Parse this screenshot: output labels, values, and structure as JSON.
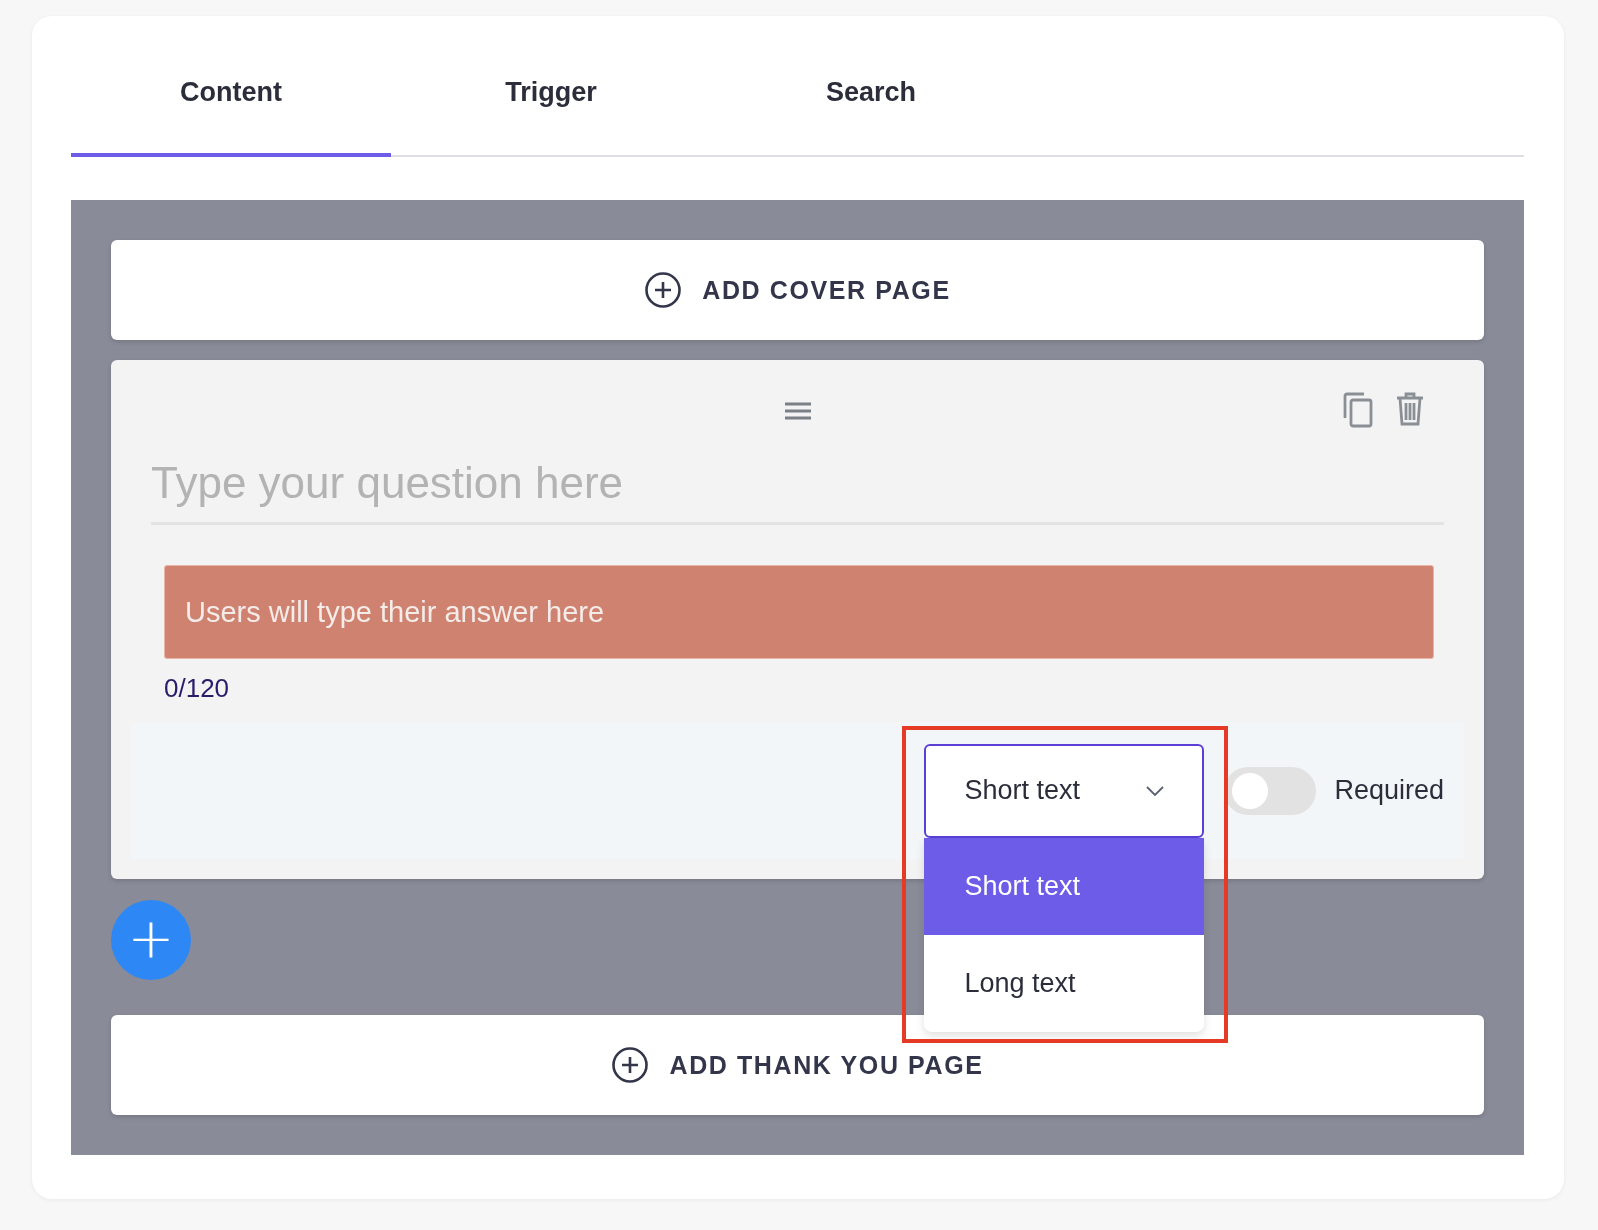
{
  "tabs": [
    {
      "label": "Content",
      "selected": true
    },
    {
      "label": "Trigger",
      "selected": false
    },
    {
      "label": "Search",
      "selected": false
    }
  ],
  "cover_button": {
    "label": "ADD COVER PAGE"
  },
  "question": {
    "placeholder": "Type your question here",
    "answer_placeholder": "Users will type their answer here",
    "char_count": "0/120",
    "type_select": {
      "value": "Short text",
      "expanded": true,
      "options": [
        {
          "label": "Short text",
          "selected": true
        },
        {
          "label": "Long text",
          "selected": false
        }
      ]
    },
    "required": {
      "label": "Required",
      "on": false
    }
  },
  "add_question_button": {
    "label": "+"
  },
  "thank_you_button": {
    "label": "ADD THANK YOU PAGE"
  }
}
